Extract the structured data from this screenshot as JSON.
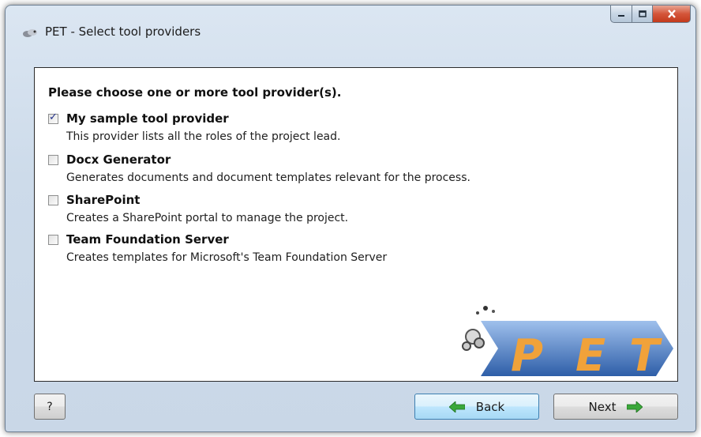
{
  "window": {
    "title": "PET - Select tool providers",
    "icon": "pet-app-icon",
    "buttons": {
      "minimize": "minimize-icon",
      "maximize": "maximize-icon",
      "close": "close-icon"
    }
  },
  "content": {
    "heading": "Please choose one or more tool provider(s).",
    "providers": [
      {
        "name": "My sample tool provider",
        "description": "This provider lists all the roles of the project lead.",
        "checked": true
      },
      {
        "name": "Docx Generator",
        "description": "Generates documents and document templates relevant for the process.",
        "checked": false
      },
      {
        "name": "SharePoint",
        "description": "Creates a SharePoint portal to manage the project.",
        "checked": false
      },
      {
        "name": "Team Foundation Server",
        "description": "Creates templates for Microsoft's Team Foundation Server",
        "checked": false
      }
    ],
    "logo": {
      "letters": [
        "P",
        "E",
        "T"
      ],
      "accent": "#f0a23a",
      "arrow_color": "#3e6fb6"
    }
  },
  "footer": {
    "help_label": "?",
    "back_label": "Back",
    "next_label": "Next",
    "arrow_color": "#3aa83a"
  }
}
